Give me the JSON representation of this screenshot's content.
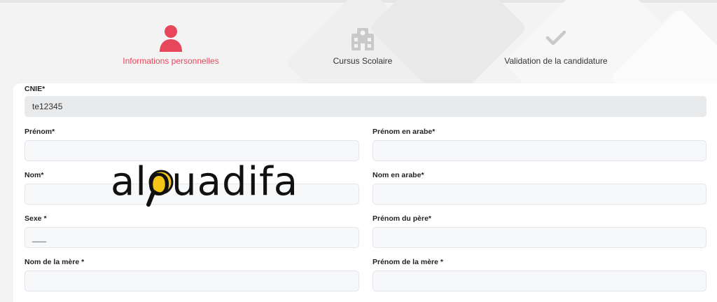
{
  "steps": [
    {
      "label": "Informations personnelles",
      "icon": "user-icon",
      "active": true
    },
    {
      "label": "Cursus Scolaire",
      "icon": "school-building-icon",
      "active": false
    },
    {
      "label": "Validation de la candidature",
      "icon": "checkmark-icon",
      "active": false
    }
  ],
  "form": {
    "cnie": {
      "label": "CNIE*",
      "value": "te12345"
    },
    "prenom": {
      "label": "Prénom*",
      "value": ""
    },
    "prenom_arabe": {
      "label": "Prénom en arabe*",
      "value": ""
    },
    "nom": {
      "label": "Nom*",
      "value": ""
    },
    "nom_arabe": {
      "label": "Nom en arabe*",
      "value": ""
    },
    "sexe": {
      "label": "Sexe *",
      "value": "___"
    },
    "prenom_pere": {
      "label": "Prénom du père*",
      "value": ""
    },
    "nom_mere": {
      "label": "Nom de la mère *",
      "value": ""
    },
    "prenom_mere": {
      "label": "Prénom de la mère *",
      "value": ""
    }
  },
  "watermark": {
    "text": "alouadifa",
    "icon": "magnifier-icon"
  },
  "colors": {
    "accent": "#e8465a",
    "inactive_icon": "#c9c9c9",
    "logo_yellow": "#f5c518"
  }
}
